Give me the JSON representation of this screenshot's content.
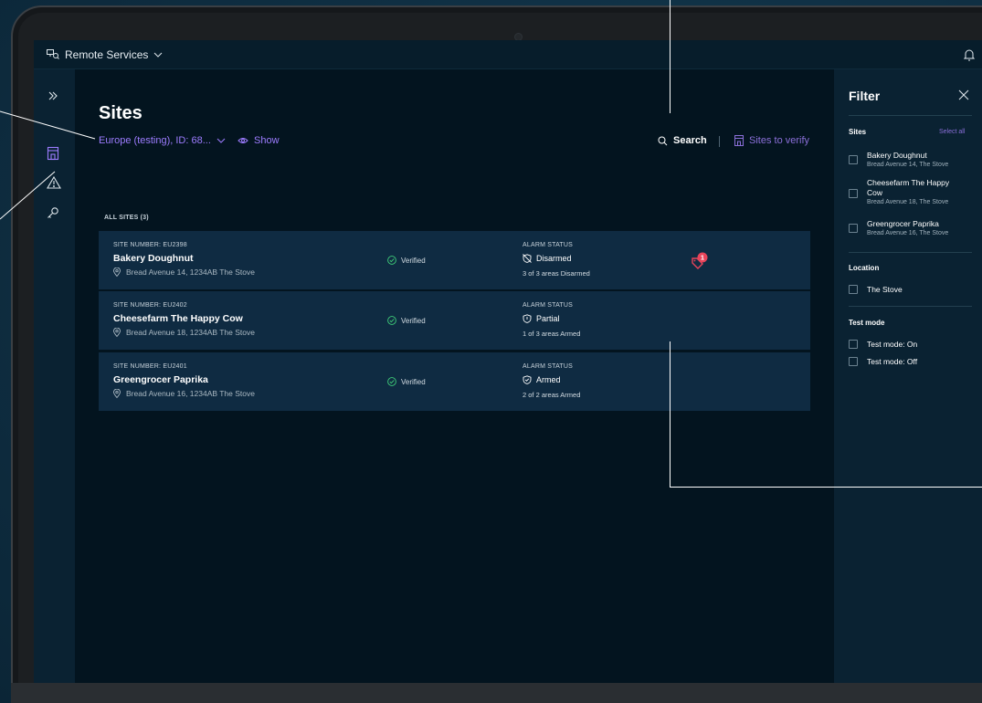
{
  "app": {
    "title": "Remote Services"
  },
  "page": {
    "title": "Sites",
    "scope_label": "Europe (testing), ID: 68...",
    "show_label": "Show",
    "search_label": "Search",
    "verify_label": "Sites to verify",
    "all_sites_label": "ALL SITES (3)"
  },
  "sites": [
    {
      "number": "SITE NUMBER: EU2398",
      "name": "Bakery Doughnut",
      "address": "Bread Avenue 14, 1234AB The Stove",
      "verification": "Verified",
      "alarm_heading": "ALARM STATUS",
      "alarm_state": "Disarmed",
      "alarm_detail": "3 of 3 areas Disarmed",
      "warning_count": "1"
    },
    {
      "number": "SITE NUMBER: EU2402",
      "name": "Cheesefarm The Happy Cow",
      "address": "Bread Avenue 18, 1234AB The Stove",
      "verification": "Verified",
      "alarm_heading": "ALARM STATUS",
      "alarm_state": "Partial",
      "alarm_detail": "1 of 3 areas Armed"
    },
    {
      "number": "SITE NUMBER: EU2401",
      "name": "Greengrocer Paprika",
      "address": "Bread Avenue 16, 1234AB The Stove",
      "verification": "Verified",
      "alarm_heading": "ALARM STATUS",
      "alarm_state": "Armed",
      "alarm_detail": "2 of 2 areas Armed"
    }
  ],
  "filter": {
    "title": "Filter",
    "sites_heading": "Sites",
    "select_all": "Select all",
    "site_options": [
      {
        "name": "Bakery Doughnut",
        "address": "Bread Avenue 14, The Stove"
      },
      {
        "name": "Cheesefarm The Happy Cow",
        "address": "Bread Avenue 18, The Stove"
      },
      {
        "name": "Greengrocer Paprika",
        "address": "Bread Avenue 16, The Stove"
      }
    ],
    "location_heading": "Location",
    "location_options": [
      {
        "name": "The Stove"
      }
    ],
    "test_mode_heading": "Test mode",
    "test_mode_options": [
      {
        "name": "Test mode: On"
      },
      {
        "name": "Test mode: Off"
      }
    ]
  },
  "colors": {
    "accent": "#9d7cff",
    "card": "#0f2b42",
    "warning": "#e8445a"
  }
}
